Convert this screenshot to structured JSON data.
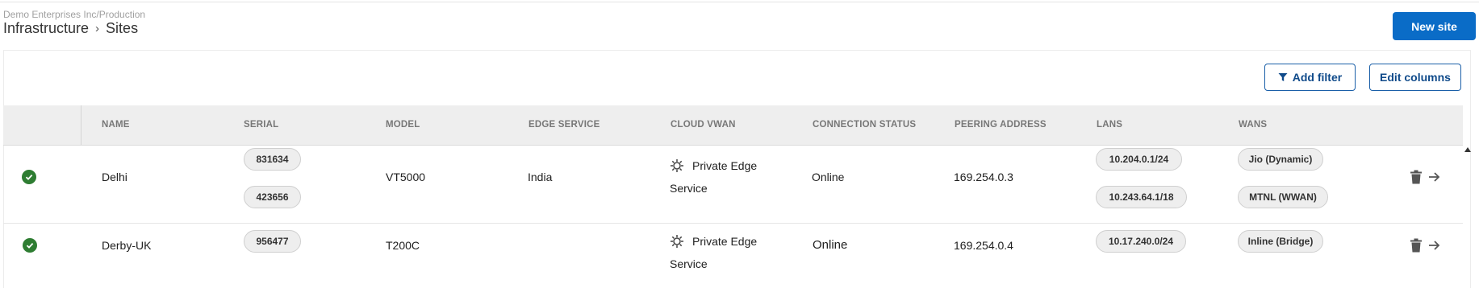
{
  "header": {
    "org_path": "Demo Enterprises Inc/Production",
    "breadcrumb_parent": "Infrastructure",
    "breadcrumb_separator": "›",
    "breadcrumb_current": "Sites",
    "new_site_label": "New site"
  },
  "toolbar": {
    "add_filter_label": "Add filter",
    "edit_columns_label": "Edit columns"
  },
  "table": {
    "columns": [
      "NAME",
      "SERIAL",
      "MODEL",
      "EDGE SERVICE",
      "CLOUD VWAN",
      "CONNECTION STATUS",
      "PEERING ADDRESS",
      "LANS",
      "WANS"
    ],
    "rows": [
      {
        "status": "ok",
        "name": "Delhi",
        "serials": [
          "831634",
          "423656"
        ],
        "model": "VT5000",
        "edge_service": "India",
        "cloud_vwan_line1": "Private Edge",
        "cloud_vwan_line2": "Service",
        "connection_status": "Online",
        "peering_address": "169.254.0.3",
        "lans": [
          "10.204.0.1/24",
          "10.243.64.1/18"
        ],
        "wans": [
          "Jio (Dynamic)",
          "MTNL (WWAN)"
        ]
      },
      {
        "status": "ok",
        "name": "Derby-UK",
        "serials": [
          "956477"
        ],
        "model": "T200C",
        "edge_service": "",
        "cloud_vwan_line1": "Private Edge",
        "cloud_vwan_line2": "Service",
        "connection_status": "Online",
        "peering_address": "169.254.0.4",
        "lans": [
          "10.17.240.0/24"
        ],
        "wans": [
          "Inline (Bridge)"
        ]
      }
    ]
  },
  "colors": {
    "primary": "#0a6cc7",
    "status_ok": "#2e7d32",
    "header_bg": "#eeeeee"
  },
  "icons": {
    "filter": "filter-icon",
    "status": "check-circle-icon",
    "vwan": "cloud-vwan-icon",
    "delete": "trash-icon",
    "open": "arrow-right-icon"
  }
}
